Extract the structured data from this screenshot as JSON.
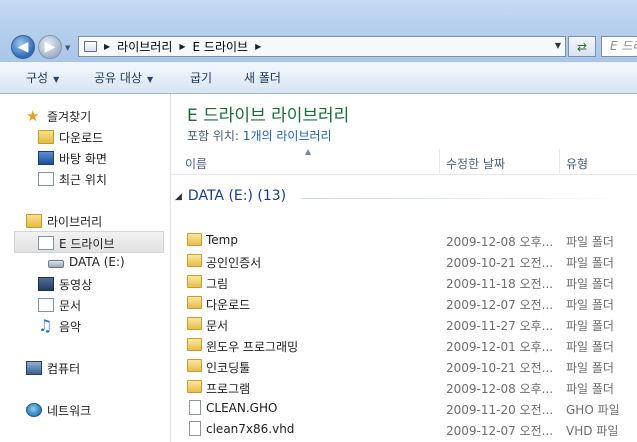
{
  "address": {
    "path": [
      "라이브러리",
      "E 드라이브"
    ],
    "search_placeholder": "E 드라이"
  },
  "toolbar": {
    "organize": "구성",
    "share_with": "공유 대상",
    "burn": "굽기",
    "new_folder": "새 폴더"
  },
  "sidebar": {
    "favorites": {
      "label": "즐겨찾기",
      "icon": "star-icon"
    },
    "favorites_items": [
      {
        "label": "다운로드",
        "icon": "downloads-folder-icon"
      },
      {
        "label": "바탕 화면",
        "icon": "desktop-icon"
      },
      {
        "label": "최근 위치",
        "icon": "recent-places-icon"
      }
    ],
    "libraries": {
      "label": "라이브러리",
      "icon": "library-icon"
    },
    "library_items": [
      {
        "label": "E 드라이브",
        "icon": "library-doc-icon",
        "selected": true
      },
      {
        "label": "DATA (E:)",
        "icon": "drive-icon"
      },
      {
        "label": "동영상",
        "icon": "videos-icon"
      },
      {
        "label": "문서",
        "icon": "documents-icon"
      },
      {
        "label": "음악",
        "icon": "music-icon"
      }
    ],
    "computer": {
      "label": "컴퓨터",
      "icon": "computer-icon"
    },
    "network": {
      "label": "네트워크",
      "icon": "network-icon"
    }
  },
  "content": {
    "title": "E 드라이브 라이브러리",
    "includes_label": "포함 위치:",
    "includes_link": "1개의 라이브러리",
    "columns": {
      "name": "이름",
      "date_modified": "수정한 날짜",
      "type": "유형"
    },
    "group_label": "DATA (E:) (13)",
    "files": [
      {
        "name": "Temp",
        "date": "2009-12-08 오후...",
        "type": "파일 폴더",
        "kind": "folder"
      },
      {
        "name": "공인인증서",
        "date": "2009-10-21 오전...",
        "type": "파일 폴더",
        "kind": "folder"
      },
      {
        "name": "그림",
        "date": "2009-11-18 오전...",
        "type": "파일 폴더",
        "kind": "folder"
      },
      {
        "name": "다운로드",
        "date": "2009-12-07 오전...",
        "type": "파일 폴더",
        "kind": "folder"
      },
      {
        "name": "문서",
        "date": "2009-11-27 오후...",
        "type": "파일 폴더",
        "kind": "folder"
      },
      {
        "name": "윈도우 프로그래밍",
        "date": "2009-12-01 오후...",
        "type": "파일 폴더",
        "kind": "folder"
      },
      {
        "name": "인코딩툴",
        "date": "2009-10-21 오전...",
        "type": "파일 폴더",
        "kind": "folder"
      },
      {
        "name": "프로그램",
        "date": "2009-12-08 오후...",
        "type": "파일 폴더",
        "kind": "folder"
      },
      {
        "name": "CLEAN.GHO",
        "date": "2009-11-20 오전...",
        "type": "GHO 파일",
        "kind": "file"
      },
      {
        "name": "clean7x86.vhd",
        "date": "2009-12-07 오전...",
        "type": "VHD 파일",
        "kind": "file"
      }
    ]
  }
}
